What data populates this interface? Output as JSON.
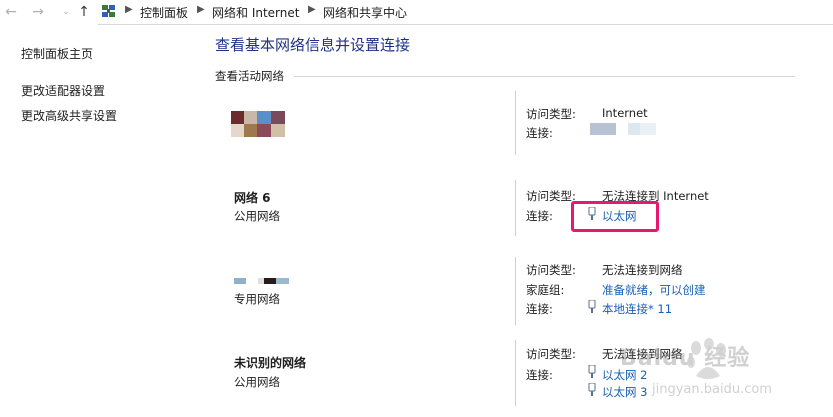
{
  "breadcrumb": {
    "items": [
      "控制面板",
      "网络和 Internet",
      "网络和共享中心"
    ]
  },
  "sidebar": {
    "items": [
      {
        "label": "控制面板主页"
      },
      {
        "label": "更改适配器设置"
      },
      {
        "label": "更改高级共享设置"
      }
    ]
  },
  "main": {
    "title": "查看基本网络信息并设置连接",
    "section_title": "查看活动网络",
    "networks": [
      {
        "name": "",
        "type": "",
        "access_label": "访问类型:",
        "access_value": "Internet",
        "connection_label": "连接:"
      },
      {
        "name": "网络  6",
        "type": "公用网络",
        "access_label": "访问类型:",
        "access_value": "无法连接到 Internet",
        "connection_label": "连接:",
        "connection_value": "以太网"
      },
      {
        "name": "",
        "type": "专用网络",
        "access_label": "访问类型:",
        "access_value": "无法连接到网络",
        "homegroup_label": "家庭组:",
        "homegroup_value": "准备就绪，可以创建",
        "connection_label": "连接:",
        "connection_value": "本地连接* 11"
      },
      {
        "name": "未识别的网络",
        "type": "公用网络",
        "access_label": "访问类型:",
        "access_value": "无法连接到网络",
        "connection_label": "连接:",
        "connection_value_1": "以太网 2",
        "connection_value_2": "以太网 3"
      }
    ]
  },
  "watermark": {
    "text": "Baidu 经验",
    "url": "jingyan.baidu.com"
  },
  "colors": {
    "link": "#1a5fb4",
    "title": "#1e3287",
    "highlight": "#e8176f"
  }
}
